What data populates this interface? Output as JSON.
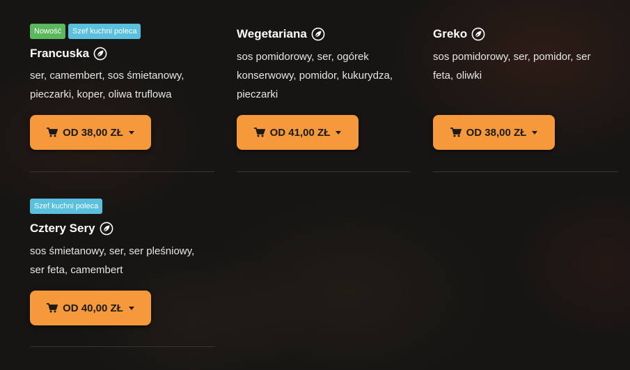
{
  "products": [
    {
      "badges": [
        "Nowość",
        "Szef kuchni poleca"
      ],
      "name": "Francuska",
      "icon": "leaf-icon",
      "description_lines": [
        "ser, camembert, sos śmietanowy,",
        "pieczarki, koper, oliwa truflowa"
      ],
      "price_label": "OD 38,00 ZŁ"
    },
    {
      "badges": [],
      "name": "Wegetariana",
      "icon": "leaf-icon",
      "description_lines": [
        "sos pomidorowy, ser, ogórek",
        "konserwowy, pomidor, kukurydza,",
        "pieczarki"
      ],
      "price_label": "OD 41,00 ZŁ"
    },
    {
      "badges": [],
      "name": "Greko",
      "icon": "leaf-icon",
      "description_lines": [
        "sos pomidorowy, ser, pomidor, ser",
        "feta, oliwki"
      ],
      "price_label": "OD 38,00 ZŁ"
    },
    {
      "badges": [
        "Szef kuchni poleca"
      ],
      "name": "Cztery Sery",
      "icon": "leaf-icon",
      "description_lines": [
        "sos śmietanowy, ser, ser pleśniowy,",
        "ser feta, camembert"
      ],
      "price_label": "OD 40,00 ZŁ"
    }
  ],
  "colors": {
    "button": "#f5993a",
    "badge_new": "#5cb85c",
    "badge_chef": "#5bc0de"
  }
}
